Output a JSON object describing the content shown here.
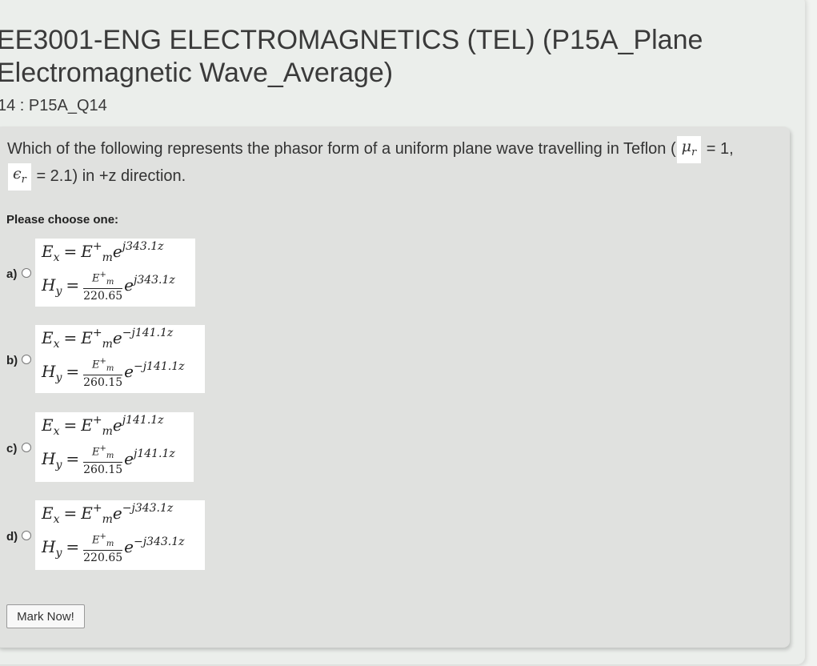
{
  "page": {
    "title": "EE3001-ENG ELECTROMAGNETICS (TEL) (P15A_Plane Electromagnetic Wave_Average)",
    "subtitle": "14 : P15A_Q14"
  },
  "question": {
    "text_part1": "Which of the following represents the phasor form of a uniform plane wave travelling in Teflon (",
    "mu_symbol": "μ",
    "mu_sub": "r",
    "text_part2": "= 1,",
    "eps_symbol": "ϵ",
    "eps_sub": "r",
    "text_part3": "= 2.1) in +z direction."
  },
  "prompt": "Please choose one:",
  "options": [
    {
      "label": "a)",
      "ex_exp": "j343.1z",
      "den": "220.65",
      "hy_exp": "j343.1z"
    },
    {
      "label": "b)",
      "ex_exp": "−j141.1z",
      "den": "260.15",
      "hy_exp": "−j141.1z"
    },
    {
      "label": "c)",
      "ex_exp": "j141.1z",
      "den": "260.15",
      "hy_exp": "j141.1z"
    },
    {
      "label": "d)",
      "ex_exp": "−j343.1z",
      "den": "220.65",
      "hy_exp": "−j343.1z"
    }
  ],
  "equation": {
    "ex_E": "E",
    "ex_sub": "x",
    "eq": "=",
    "em_E": "E",
    "em_sup": "+",
    "em_sub": "m",
    "e": "e",
    "hy_H": "H",
    "hy_sub": "y",
    "num": "E",
    "num_sup": "+",
    "num_sub": "m"
  },
  "buttons": {
    "mark": "Mark Now!"
  }
}
